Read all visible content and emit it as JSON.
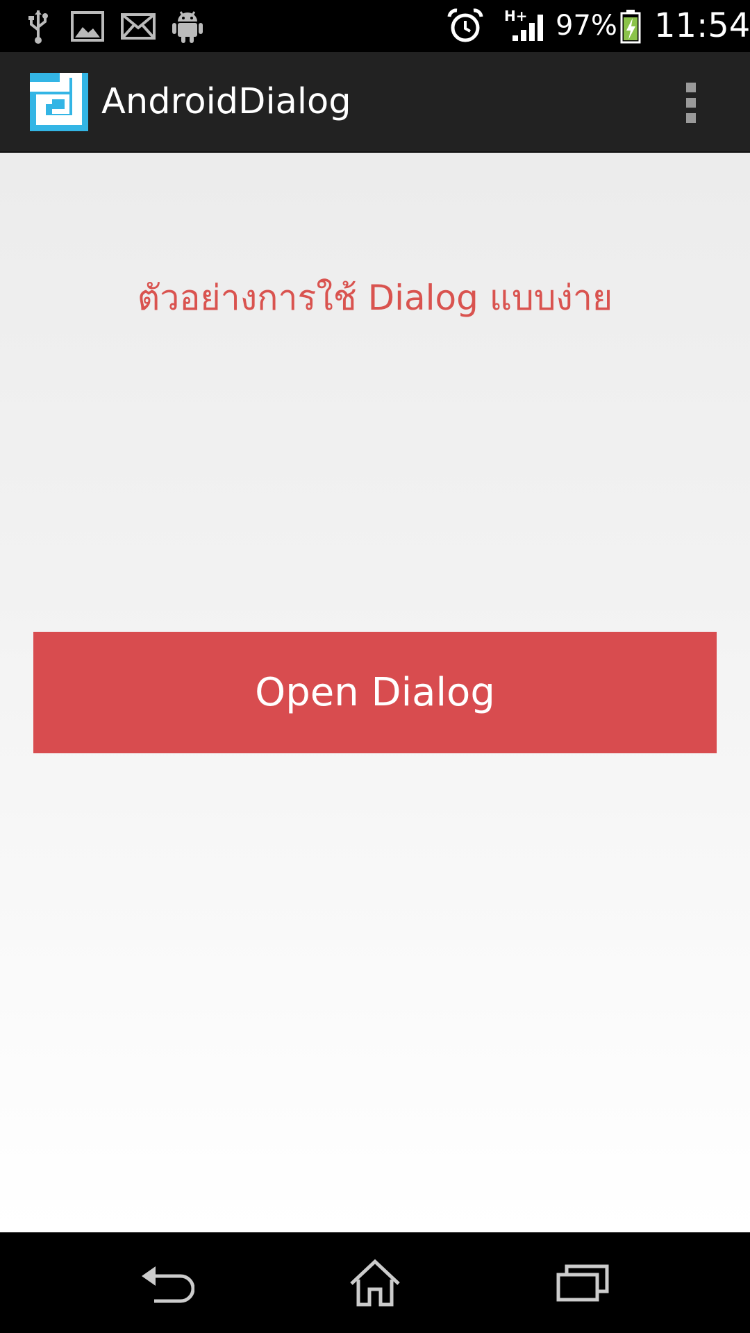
{
  "status_bar": {
    "icons": [
      "usb-icon",
      "image-icon",
      "mail-icon",
      "android-icon",
      "alarm-icon",
      "signal-icon",
      "battery-charging-icon"
    ],
    "network_type": "H+",
    "battery_percent": "97%",
    "time": "11:54"
  },
  "action_bar": {
    "logo_icon": "app-logo-icon",
    "title": "AndroidDialog",
    "overflow_icon": "overflow-menu-icon"
  },
  "main": {
    "heading": "ตัวอย่างการใช้ Dialog แบบง่าย",
    "button_label": "Open Dialog"
  },
  "nav_bar": {
    "icons": [
      "back-icon",
      "home-icon",
      "recent-apps-icon"
    ]
  },
  "colors": {
    "accent_red": "#d84c4f",
    "heading_red": "#d9534f",
    "logo_blue": "#33b5e5",
    "action_bar_bg": "#222222"
  }
}
